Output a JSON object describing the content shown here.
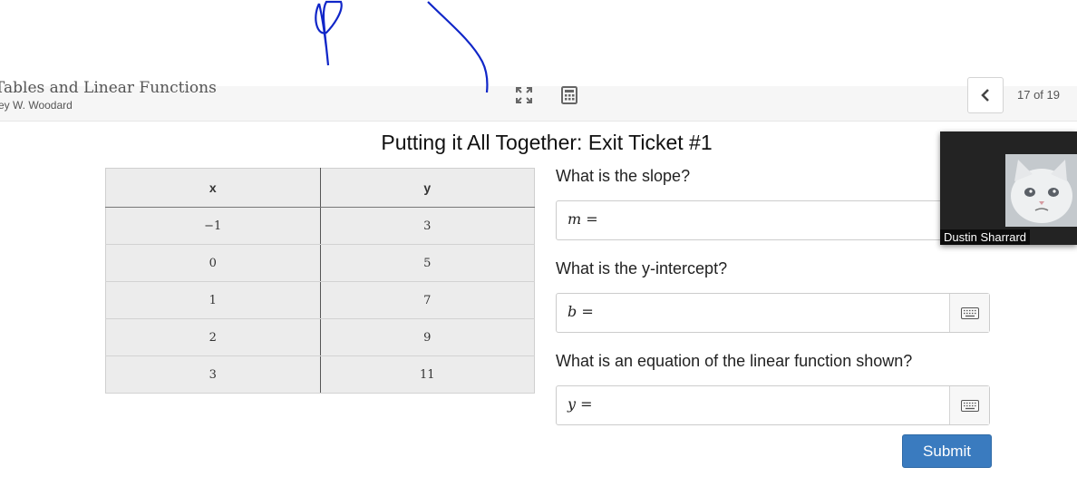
{
  "lesson": {
    "title": "Tables and Linear Functions",
    "author": "ey W. Woodard"
  },
  "toolbar": {
    "fullscreen_icon": "expand-icon",
    "calculator_icon": "calculator-icon",
    "prev_icon": "chevron-left-icon",
    "page_counter": "17 of 19"
  },
  "problem": {
    "title": "Putting it All Together: Exit Ticket #1",
    "table": {
      "headers": [
        "x",
        "y"
      ],
      "rows": [
        [
          "−1",
          "3"
        ],
        [
          "0",
          "5"
        ],
        [
          "1",
          "7"
        ],
        [
          "2",
          "9"
        ],
        [
          "3",
          "11"
        ]
      ]
    },
    "questions": [
      {
        "label": "What is the slope?",
        "prefix": "m ="
      },
      {
        "label": "What is the y-intercept?",
        "prefix": "b ="
      },
      {
        "label": "What is an equation of the linear function shown?",
        "prefix": "y ="
      }
    ],
    "submit_label": "Submit"
  },
  "video_overlay": {
    "participant_name": "Dustin Sharrard",
    "avatar": "crying-cat-avatar"
  },
  "colors": {
    "submit": "#3a7bbf",
    "ink": "#1026c8",
    "video_bg": "#232323"
  }
}
